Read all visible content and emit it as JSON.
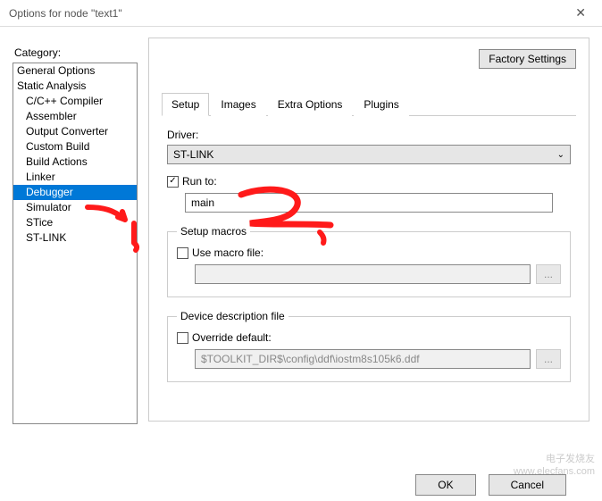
{
  "window": {
    "title": "Options for node \"text1\""
  },
  "sidebar": {
    "label": "Category:",
    "items": [
      {
        "label": "General Options",
        "indent": false,
        "selected": false
      },
      {
        "label": "Static Analysis",
        "indent": false,
        "selected": false
      },
      {
        "label": "C/C++ Compiler",
        "indent": true,
        "selected": false
      },
      {
        "label": "Assembler",
        "indent": true,
        "selected": false
      },
      {
        "label": "Output Converter",
        "indent": true,
        "selected": false
      },
      {
        "label": "Custom Build",
        "indent": true,
        "selected": false
      },
      {
        "label": "Build Actions",
        "indent": true,
        "selected": false
      },
      {
        "label": "Linker",
        "indent": true,
        "selected": false
      },
      {
        "label": "Debugger",
        "indent": true,
        "selected": true
      },
      {
        "label": "Simulator",
        "indent": true,
        "selected": false
      },
      {
        "label": "STice",
        "indent": true,
        "selected": false
      },
      {
        "label": "ST-LINK",
        "indent": true,
        "selected": false
      }
    ]
  },
  "panel": {
    "factory_btn": "Factory Settings",
    "tabs": [
      {
        "label": "Setup",
        "active": true
      },
      {
        "label": "Images",
        "active": false
      },
      {
        "label": "Extra Options",
        "active": false
      },
      {
        "label": "Plugins",
        "active": false
      }
    ],
    "driver_label": "Driver:",
    "driver_value": "ST-LINK",
    "run_to_checked": true,
    "run_to_label": "Run to:",
    "run_to_value": "main",
    "macros_group": "Setup macros",
    "use_macro_label": "Use macro file:",
    "use_macro_checked": false,
    "macro_file_value": "",
    "browse_label": "...",
    "ddf_group": "Device description file",
    "override_label": "Override default:",
    "override_checked": false,
    "ddf_value": "$TOOLKIT_DIR$\\config\\ddf\\iostm8s105k6.ddf"
  },
  "footer": {
    "ok": "OK",
    "cancel": "Cancel"
  },
  "watermark": {
    "line1": "电子发烧友",
    "line2": "www.elecfans.com"
  }
}
